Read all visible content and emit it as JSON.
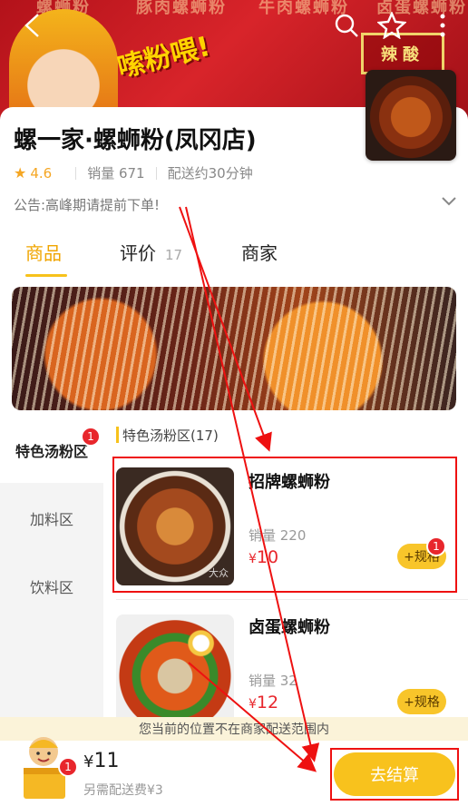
{
  "banner": {
    "stripe_texts": [
      "螺蛳粉",
      "豚肉螺蛳粉",
      "牛肉螺蛳粉",
      "卤蛋螺蛳粉"
    ],
    "slogan": "嗦粉喂!",
    "sign_text": "辣酸",
    "icons": [
      "back-arrow-icon",
      "search-icon",
      "star-icon",
      "more-icon"
    ]
  },
  "store": {
    "name": "螺一家·螺蛳粉(凤冈店)",
    "rating": "4.6",
    "sales": "销量 671",
    "delivery_time": "配送约30分钟",
    "notice": "公告:高峰期请提前下单!"
  },
  "tabs": [
    {
      "label": "商品",
      "count": ""
    },
    {
      "label": "评价",
      "count": "17"
    },
    {
      "label": "商家",
      "count": ""
    }
  ],
  "categories": [
    {
      "label": "特色汤粉区",
      "badge": "1"
    },
    {
      "label": "加料区",
      "badge": ""
    },
    {
      "label": "饮料区",
      "badge": ""
    }
  ],
  "section_title": "特色汤粉区(17)",
  "products": [
    {
      "name": "招牌螺蛳粉",
      "sales": "销量 220",
      "price": "10",
      "spec_label": "+规格",
      "badge": "1",
      "watermark": "大众"
    },
    {
      "name": "卤蛋螺蛳粉",
      "sales": "销量 32",
      "price": "12",
      "spec_label": "+规格",
      "badge": ""
    }
  ],
  "warning": "您当前的位置不在商家配送范围内",
  "cart": {
    "badge": "1",
    "total": "11",
    "currency": "¥",
    "delivery_fee": "另需配送费¥3",
    "checkout_label": "去结算"
  },
  "colors": {
    "accent": "#f8c21d",
    "price": "#e8262c",
    "annotation": "#e11111"
  }
}
